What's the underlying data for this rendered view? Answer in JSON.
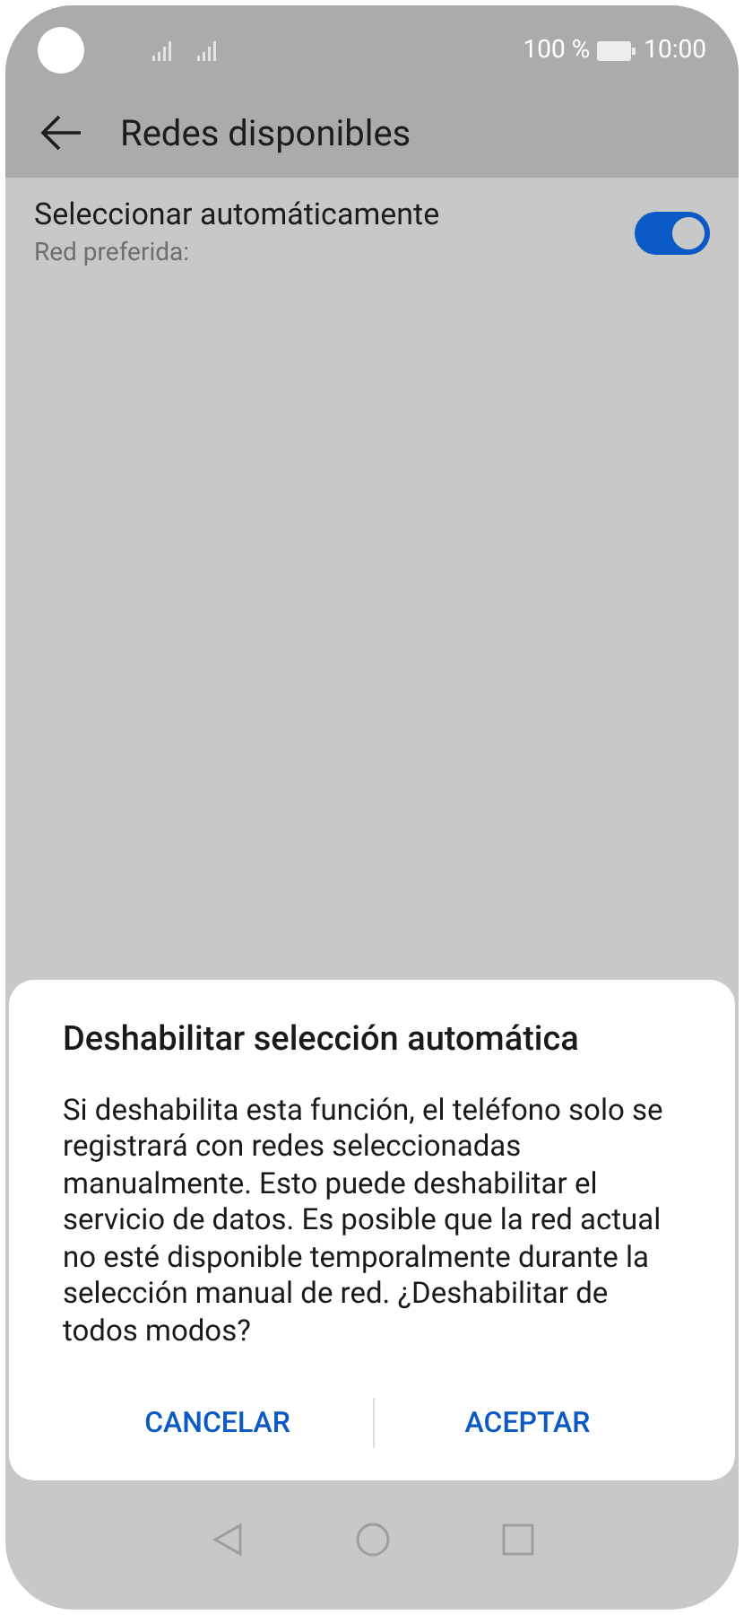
{
  "status_bar": {
    "battery": "100 %",
    "time": "10:00"
  },
  "header": {
    "title": "Redes disponibles"
  },
  "setting": {
    "title": "Seleccionar automáticamente",
    "subtitle": "Red preferida:",
    "on": true
  },
  "dialog": {
    "title": "Deshabilitar selección automática",
    "message": "Si deshabilita esta función, el teléfono solo se registrará con redes seleccionadas manualmente. Esto puede deshabilitar el servicio de datos. Es posible que la red actual no esté disponible temporalmente durante la selección manual de red. ¿Deshabilitar de todos modos?",
    "buttons": [
      "CANCELAR",
      "ACEPTAR"
    ]
  }
}
